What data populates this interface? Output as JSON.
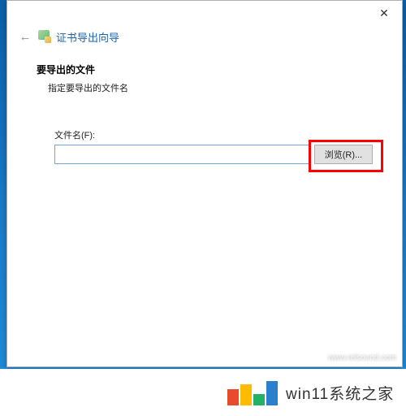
{
  "dialog": {
    "title": "证书导出向导",
    "section_heading": "要导出的文件",
    "section_sub": "指定要导出的文件名",
    "field_label": "文件名(F):",
    "filename_value": "",
    "browse_label": "浏览(R)..."
  },
  "branding": {
    "site_text": "win11系统之家",
    "watermark": "www.relsound.com"
  }
}
